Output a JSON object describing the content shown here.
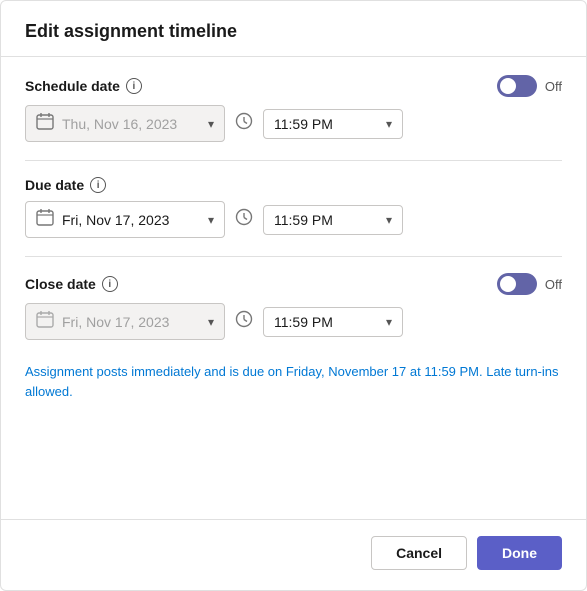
{
  "dialog": {
    "title": "Edit assignment timeline"
  },
  "schedule_date": {
    "label": "Schedule date",
    "toggle_off_label": "Off",
    "date_placeholder": "Thu, Nov 16, 2023",
    "time_value": "11:59 PM",
    "disabled": true
  },
  "due_date": {
    "label": "Due date",
    "date_value": "Fri, Nov 17, 2023",
    "time_value": "11:59 PM",
    "disabled": false
  },
  "close_date": {
    "label": "Close date",
    "toggle_off_label": "Off",
    "date_placeholder": "Fri, Nov 17, 2023",
    "time_value": "11:59 PM",
    "disabled": true
  },
  "info_text": "Assignment posts immediately and is due on Friday, November 17 at 11:59 PM. Late turn-ins allowed.",
  "footer": {
    "cancel_label": "Cancel",
    "done_label": "Done"
  },
  "icons": {
    "calendar": "📅",
    "clock": "🕐",
    "info": "i",
    "chevron": "▾"
  }
}
